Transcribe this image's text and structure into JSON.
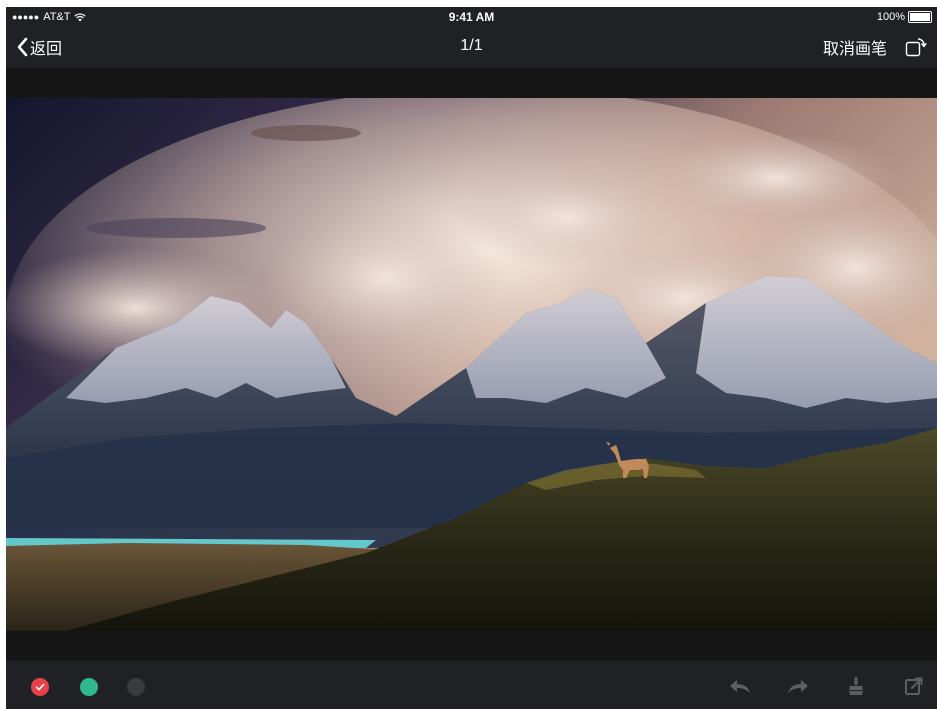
{
  "status_bar": {
    "signal": "●●●●●",
    "carrier": "AT&T",
    "time": "9:41 AM",
    "battery_text": "100%"
  },
  "nav": {
    "back_label": "返回",
    "title": "1/1",
    "cancel_pen_label": "取消画笔"
  },
  "palette": {
    "colors": [
      {
        "name": "red",
        "hex": "#e8414a",
        "selected": true
      },
      {
        "name": "green",
        "hex": "#2fb88e",
        "selected": false
      },
      {
        "name": "gray",
        "hex": "#3a3b3e",
        "selected": false
      }
    ]
  },
  "toolbar": {
    "icons": [
      "undo-icon",
      "redo-icon",
      "eraser-icon",
      "share-icon"
    ]
  },
  "colors": {
    "bar_bg": "#202124",
    "screen_bg": "#1a1b1d",
    "icon_disabled": "#5e5f62"
  }
}
